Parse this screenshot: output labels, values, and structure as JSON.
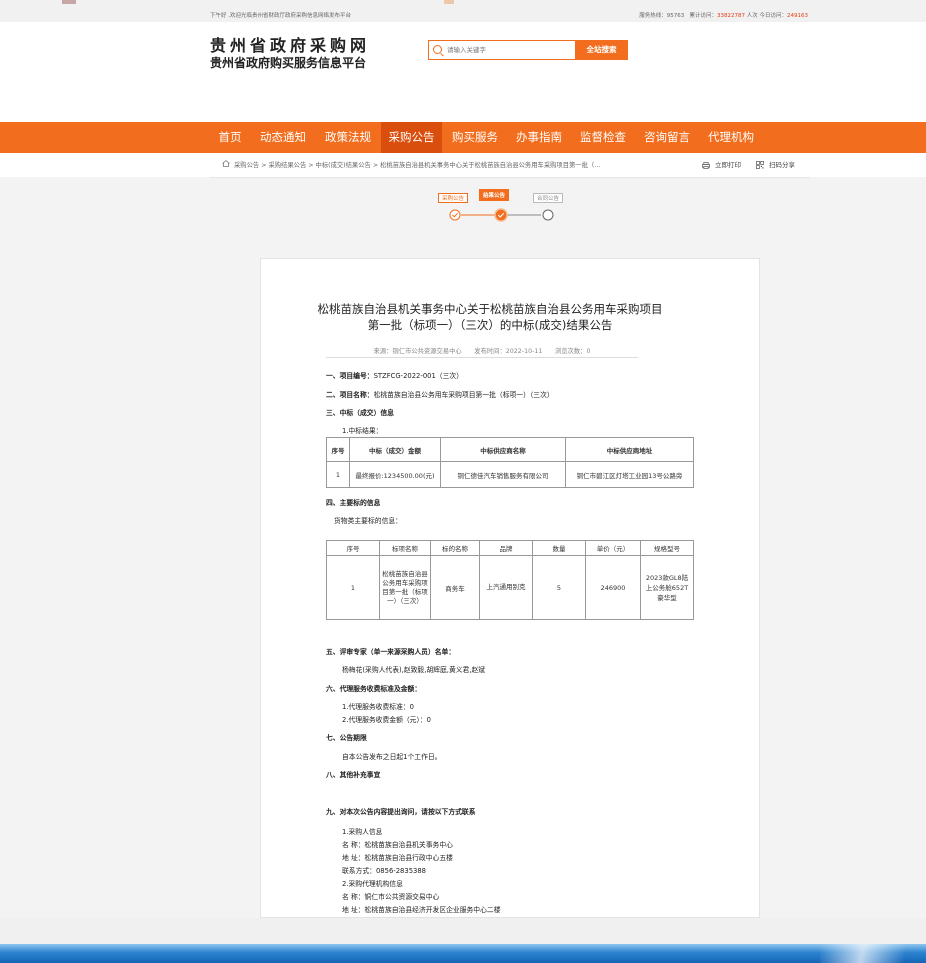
{
  "topbar": {
    "welcome": "下午好 ,欢迎光临贵州省财政厅政府采购信息网络发布平台",
    "stats_label_1": "服务热线：",
    "stats_value_1": "95763",
    "stats_label_2": "累计访问：",
    "stats_value_2": "33822787",
    "stats_label_3": "人次 今日访问：",
    "stats_value_3": "249163"
  },
  "header": {
    "logo_title": "贵州省政府采购网",
    "logo_subtitle": "贵州省政府购买服务信息平台",
    "search_placeholder": "请输入关键字",
    "search_button": "全站搜索"
  },
  "nav": {
    "items": [
      "首页",
      "动态通知",
      "政策法规",
      "采购公告",
      "购买服务",
      "办事指南",
      "监督检查",
      "咨询留言",
      "代理机构"
    ],
    "active_index": 3
  },
  "breadcrumb": {
    "text": "采购公告 > 采购结果公告 > 中标(成交)结果公告 > 松桃苗族自治县机关事务中心关于松桃苗族自治县公务用车采购项目第一批（...",
    "print": "立即打印",
    "share": "扫码分享"
  },
  "steps": {
    "items": [
      "采购公告",
      "结果公告",
      "合同公告"
    ],
    "active_index": 1
  },
  "article": {
    "title_line1": "松桃苗族自治县机关事务中心关于松桃苗族自治县公务用车采购项目",
    "title_line2": "第一批（标项一）（三次）的中标(成交)结果公告",
    "meta": "来源：铜仁市公共资源交易中心　　发布时间：2022-10-11　　浏览次数：0",
    "s1_label": "一、项目编号：",
    "s1_value": "STZFCG-2022-001（三次）",
    "s2_label": "二、项目名称：",
    "s2_value": "松桃苗族自治县公务用车采购项目第一批（标项一）（三次）",
    "s3_label": "三、中标（成交）信息",
    "s3_sub": "1.中标结果：",
    "t1_headers": [
      "序号",
      "中标（成交）金额",
      "中标供应商名称",
      "中标供应商地址"
    ],
    "t1_row": [
      "1",
      "最终报价:1234500.00(元)",
      "铜仁德佳汽车销售服务有限公司",
      "铜仁市碧江区灯塔工业园13号公路旁"
    ],
    "s4_label": "四、主要标的信息",
    "s4_sub": "货物类主要标的信息：",
    "t2_headers": [
      "序号",
      "标项名称",
      "标的名称",
      "品牌",
      "数量",
      "单价（元）",
      "规格型号"
    ],
    "t2_row": [
      "1",
      "松桃苗族自治县公务用车采购项目第一批（标项一）（三次）",
      "商务车",
      "上汽通用别克",
      "5",
      "246900",
      "2023款GL8陆上公务舱652T豪华型"
    ],
    "s5_label": "五、评审专家（单一来源采购人员）名单：",
    "s5_value": "杨梅花(采购人代表),赵致毅,胡辉庭,黄义君,赵斌",
    "s6_label": "六、代理服务收费标准及金额：",
    "s6_line1": "1.代理服务收费标准：0",
    "s6_line2": "2.代理服务收费金额（元）：0",
    "s7_label": "七、公告期限",
    "s7_value": "自本公告发布之日起1个工作日。",
    "s8_label": "八、其他补充事宜",
    "s9_label": "九、对本次公告内容提出询问，请按以下方式联系",
    "s9_lines": [
      "1.采购人信息",
      "名 称：松桃苗族自治县机关事务中心",
      "地 址：松桃苗族自治县行政中心五楼",
      "联系方式：0856-2835388",
      "2.采购代理机构信息",
      "名 称：铜仁市公共资源交易中心",
      "地 址：松桃苗族自治县经济开发区企业服务中心二楼"
    ]
  },
  "colors": {
    "brand": "#f26d1d",
    "nav_active": "#d94e0c",
    "stat_red": "#e63c14"
  }
}
